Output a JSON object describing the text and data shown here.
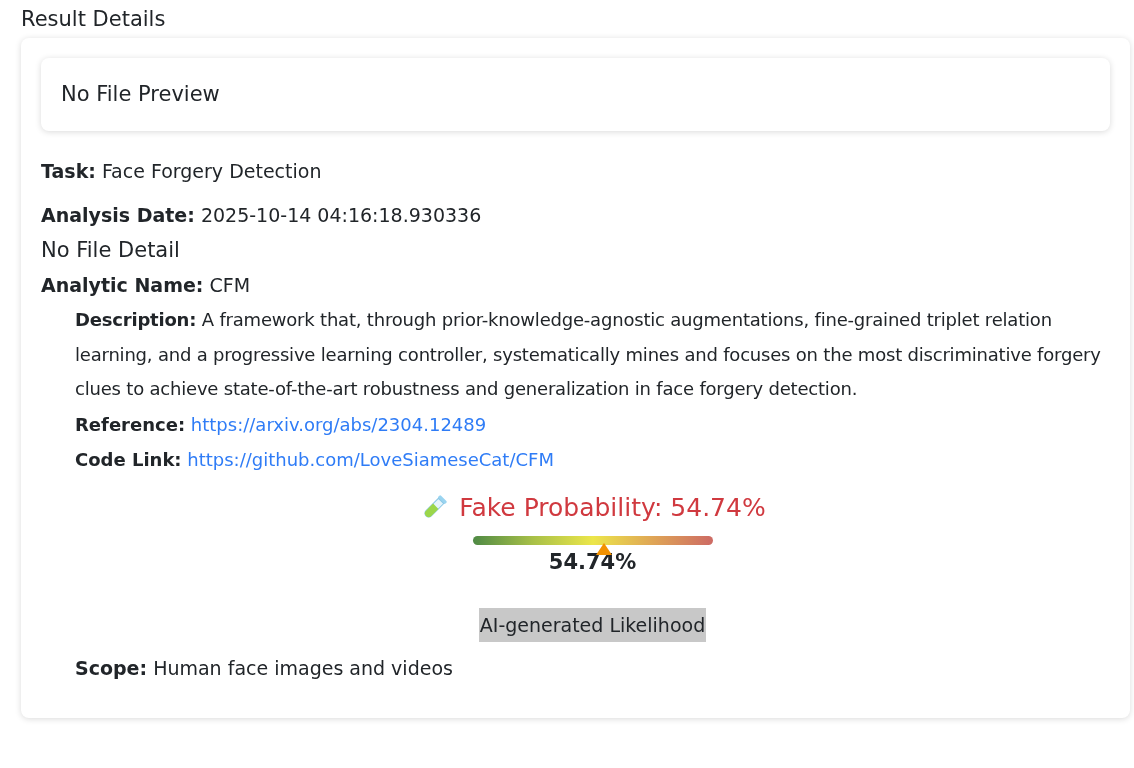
{
  "heading": "Result Details",
  "preview": "No File Preview",
  "fields": [
    {
      "text": "**Task:** Face Forgery Detection"
    },
    {
      "text": "**Analysis Date:** 2025-10-14 04:16:18.930336"
    }
  ],
  "file_detail": "No File Detail",
  "analytic": {
    "text": "**Analytic Name:** CFM",
    "description": "**Description:** A framework that, through prior-knowledge-agnostic augmentations, fine-grained triplet relation learning, and a progressive learning controller, systematically mines and focuses on the most discriminative forgery clues to achieve state-of-the-art robustness and generalization in face forgery detection.",
    "links": [
      {
        "label": "Reference:",
        "url": "https://arxiv.org/abs/2304.12489"
      },
      {
        "label": "Code Link:",
        "url": "https://github.com/LoveSiameseCat/CFM"
      }
    ],
    "probability": {
      "title": "Fake Probability: 54.74%",
      "level": 0.5474,
      "reading": "54.74%",
      "caption": "AI-generated Likelihood"
    },
    "scope": "**Scope:** Human face images and videos"
  }
}
